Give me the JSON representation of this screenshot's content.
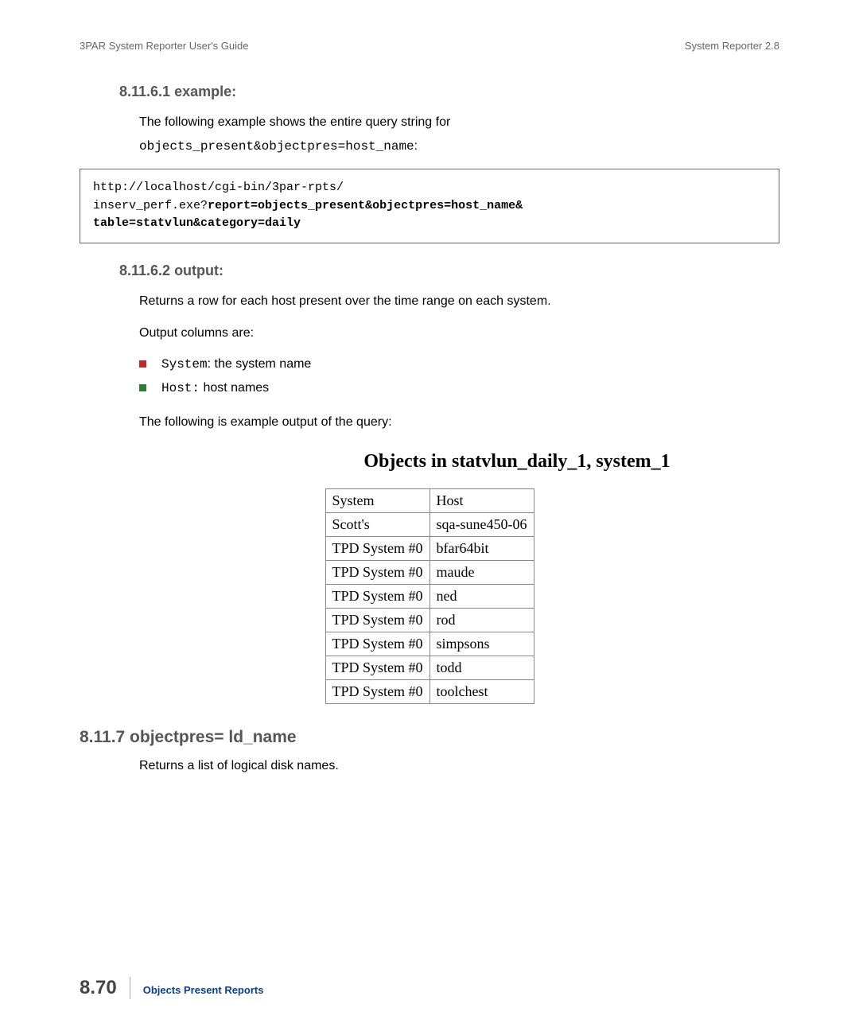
{
  "header": {
    "left": "3PAR System Reporter User's Guide",
    "right": "System Reporter 2.8"
  },
  "section1": {
    "heading": "8.11.6.1 example:",
    "intro": "The following example shows the entire query string for",
    "intro_code": "objects_present&objectpres=host_name",
    "code_line1": "http://localhost/cgi-bin/3par-rpts/",
    "code_line2a": "inserv_perf.exe?",
    "code_line2b": "report=objects_present&objectpres=host_name&",
    "code_line3": "table=statvlun&category=daily"
  },
  "section2": {
    "heading": "8.11.6.2 output:",
    "para1": "Returns a row for each host present over the time range on each system.",
    "para2": "Output columns are:",
    "bullets": [
      {
        "code": "System",
        "text": ": the system name"
      },
      {
        "code": "Host:",
        "text": " host names"
      }
    ],
    "para3": "The following is example output of the query:"
  },
  "table": {
    "title": "Objects in statvlun_daily_1, system_1",
    "headers": [
      "System",
      "Host"
    ],
    "rows": [
      [
        "Scott's",
        "sqa-sune450-06"
      ],
      [
        "TPD System #0",
        "bfar64bit"
      ],
      [
        "TPD System #0",
        "maude"
      ],
      [
        "TPD System #0",
        "ned"
      ],
      [
        "TPD System #0",
        "rod"
      ],
      [
        "TPD System #0",
        "simpsons"
      ],
      [
        "TPD System #0",
        "todd"
      ],
      [
        "TPD System #0",
        "toolchest"
      ]
    ]
  },
  "section3": {
    "heading": "8.11.7 objectpres= ld_name",
    "para": "Returns a list of logical disk names."
  },
  "footer": {
    "page": "8.70",
    "title": "Objects Present Reports"
  }
}
